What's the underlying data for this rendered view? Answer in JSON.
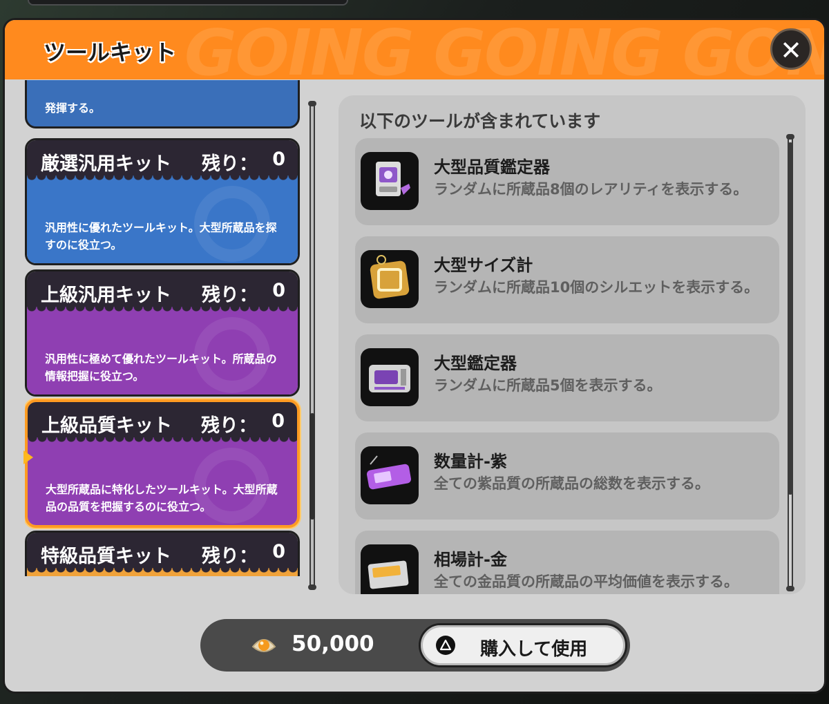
{
  "header": {
    "title": "ツールキット",
    "watermark": "GOING GOING GONE"
  },
  "close": {
    "label": "✕"
  },
  "kits": {
    "partial_desc": "発揮する。",
    "items": [
      {
        "name": "厳選汎用キット",
        "remaining_label": "残り：",
        "remaining": "0",
        "desc": "汎用性に優れたツールキット。大型所蔵品を探すのに役立つ。",
        "color": "#3a76c8"
      },
      {
        "name": "上級汎用キット",
        "remaining_label": "残り：",
        "remaining": "0",
        "desc": "汎用性に極めて優れたツールキット。所蔵品の情報把握に役立つ。",
        "color": "#8f3fb2"
      },
      {
        "name": "上級品質キット",
        "remaining_label": "残り：",
        "remaining": "0",
        "desc": "大型所蔵品に特化したツールキット。大型所蔵品の品質を把握するのに役立つ。",
        "color": "#8f3fb2",
        "selected": true
      },
      {
        "name": "特級品質キット",
        "remaining_label": "残り：",
        "remaining": "0",
        "desc": "",
        "color": "#f0a23a"
      }
    ]
  },
  "tools": {
    "heading": "以下のツールが含まれています",
    "items": [
      {
        "name": "大型品質鑑定器",
        "desc": "ランダムに所蔵品8個のレアリティを表示する。",
        "icon": "quality-appraiser-icon"
      },
      {
        "name": "大型サイズ計",
        "desc": "ランダムに所蔵品10個のシルエットを表示する。",
        "icon": "size-meter-icon"
      },
      {
        "name": "大型鑑定器",
        "desc": "ランダムに所蔵品5個を表示する。",
        "icon": "appraiser-icon"
      },
      {
        "name": "数量計-紫",
        "desc": "全ての紫品質の所蔵品の総数を表示する。",
        "icon": "purple-counter-icon"
      },
      {
        "name": "相場計-金",
        "desc": "全ての金品質の所蔵品の平均価値を表示する。",
        "icon": "gold-price-meter-icon"
      }
    ]
  },
  "footer": {
    "price": "50,000",
    "currency_icon": "pearl-icon",
    "buy_label": "購入して使用",
    "button_icon": "triangle-button-icon"
  }
}
